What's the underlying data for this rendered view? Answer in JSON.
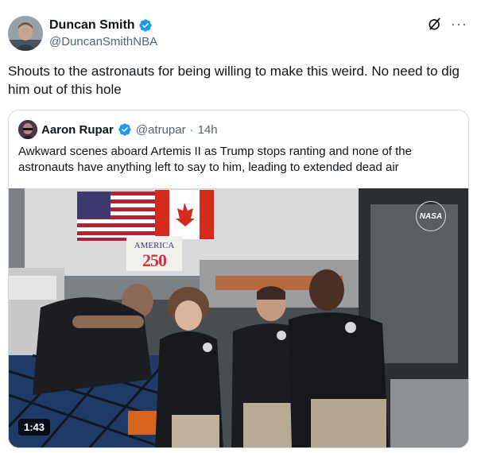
{
  "tweet": {
    "display_name": "Duncan Smith",
    "handle": "@DuncanSmithNBA",
    "text": "Shouts to the astronauts for being willing to make this weird. No need to dig him out of this hole",
    "more_label": "···",
    "verified_icon": "verified-badge-icon",
    "grok_icon": "grok-icon"
  },
  "quoted": {
    "display_name": "Aaron Rupar",
    "handle": "@atrupar",
    "separator": "·",
    "time": "14h",
    "text": "Awkward scenes aboard Artemis II as Trump stops ranting and none of the astronauts have anything left to say to him, leading to extended dead air",
    "media": {
      "duration": "1:43",
      "logo_text": "NASA",
      "banner_line1": "AMERICA",
      "banner_line2": "250"
    }
  },
  "colors": {
    "verified": "#1d9bf0",
    "text_primary": "#0f1419",
    "text_secondary": "#536471",
    "border": "#cfd9de"
  }
}
